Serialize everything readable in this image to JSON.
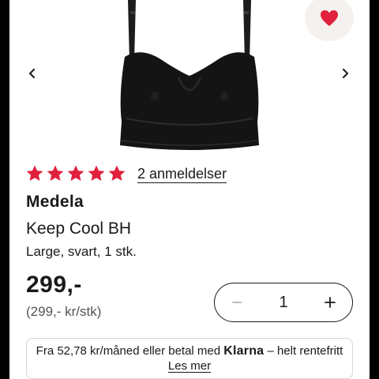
{
  "colors": {
    "star": "#e0203c",
    "heart": "#e0203c",
    "favorite_background": "#f4f1ee",
    "text": "#1a1a1a"
  },
  "gallery": {
    "prev_icon": "chevron-left-icon",
    "next_icon": "chevron-right-icon",
    "favorite_icon": "heart-icon"
  },
  "rating": {
    "stars": 5,
    "max_stars": 5,
    "reviews_label": "2 anmeldelser"
  },
  "product": {
    "brand": "Medela",
    "name": "Keep Cool BH",
    "variant": "Large, svart, 1 stk.",
    "price": "299,-",
    "unit_price": "(299,- kr/stk)"
  },
  "quantity": {
    "value": "1",
    "decrease_label": "−",
    "increase_label": "+"
  },
  "klarna": {
    "text_before": "Fra 52,78 kr/måned eller betal med",
    "logo": "Klarna",
    "text_after": "– helt rentefritt",
    "link": "Les mer"
  }
}
